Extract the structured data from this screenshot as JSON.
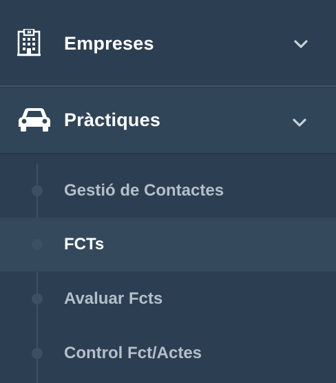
{
  "menu": {
    "empreses": {
      "label": "Empreses",
      "icon": "building-icon",
      "expanded": false
    },
    "practiques": {
      "label": "Pràctiques",
      "icon": "car-icon",
      "expanded": true,
      "items": [
        {
          "label": "Gestió de Contactes",
          "active": false
        },
        {
          "label": "FCTs",
          "active": true
        },
        {
          "label": "Avaluar Fcts",
          "active": false
        },
        {
          "label": "Control Fct/Actes",
          "active": false
        }
      ]
    }
  },
  "colors": {
    "background": "#2c3e52",
    "active_item_background": "#34495c",
    "text_primary": "#ffffff",
    "text_secondary": "#b4bfca"
  }
}
